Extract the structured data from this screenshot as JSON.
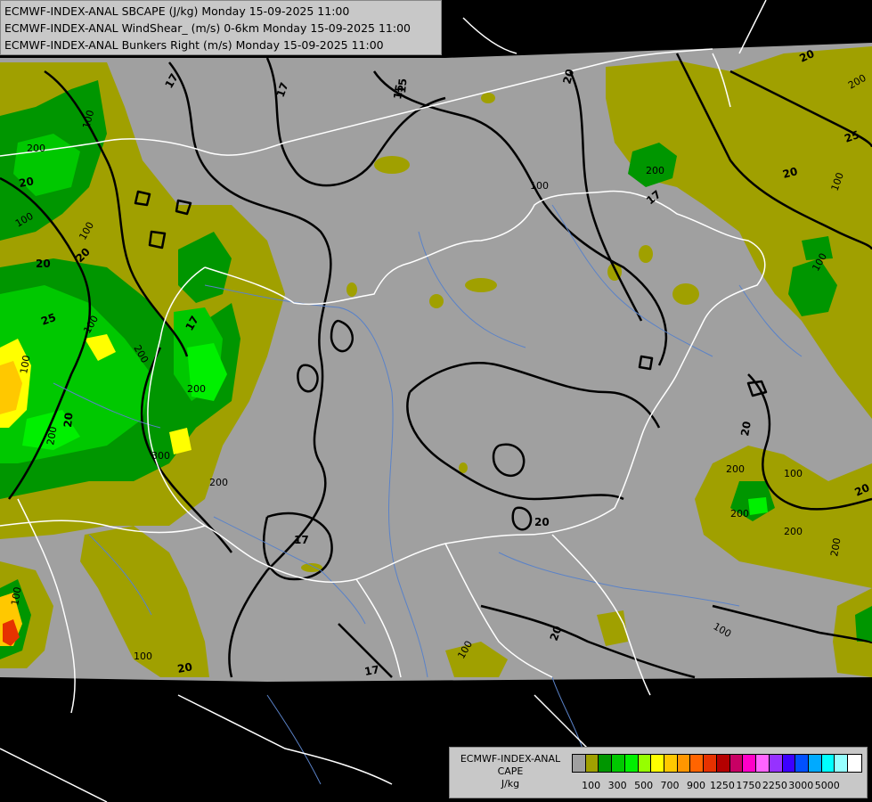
{
  "header": {
    "lines": [
      "ECMWF-INDEX-ANAL SBCAPE (J/kg) Monday 15-09-2025 11:00",
      "ECMWF-INDEX-ANAL WindShear_ (m/s) 0-6km Monday 15-09-2025 11:00",
      "ECMWF-INDEX-ANAL Bunkers Right (m/s) Monday 15-09-2025 11:00"
    ]
  },
  "legend": {
    "title_lines": [
      "ECMWF-INDEX-ANAL",
      "CAPE",
      "J/kg"
    ],
    "colors": [
      "#a0a0a0",
      "#a0a000",
      "#009600",
      "#00c800",
      "#00f000",
      "#96ff00",
      "#ffff00",
      "#ffc800",
      "#ff9600",
      "#ff6400",
      "#e63200",
      "#b40000",
      "#c80064",
      "#ff00c8",
      "#ff64ff",
      "#9632ff",
      "#3c00ff",
      "#0050ff",
      "#00aaff",
      "#00ffff",
      "#96ffff",
      "#ffffff"
    ],
    "tick_labels": [
      "100",
      "300",
      "500",
      "700",
      "900",
      "1250",
      "1750",
      "2250",
      "3000",
      "5000"
    ]
  },
  "map": {
    "field_color": "#a0a0a0",
    "outside_color": "#000000",
    "border_color": "#ffffff",
    "contour_color": "#000000",
    "river_color": "#5a82c8",
    "contour_labels": [
      "17",
      "17",
      "15",
      "20",
      "20",
      "25",
      "20",
      "20",
      "25",
      "20",
      "17",
      "20",
      "20",
      "20",
      "17",
      "17",
      "20",
      "20",
      "17",
      "20",
      "20",
      "15"
    ],
    "cape_labels": [
      "200",
      "200",
      "100",
      "200",
      "100",
      "200",
      "200",
      "200",
      "100",
      "200",
      "100",
      "100",
      "100",
      "100",
      "100",
      "300",
      "200",
      "100",
      "100",
      "100",
      "100",
      "100",
      "200",
      "200",
      "200"
    ]
  }
}
